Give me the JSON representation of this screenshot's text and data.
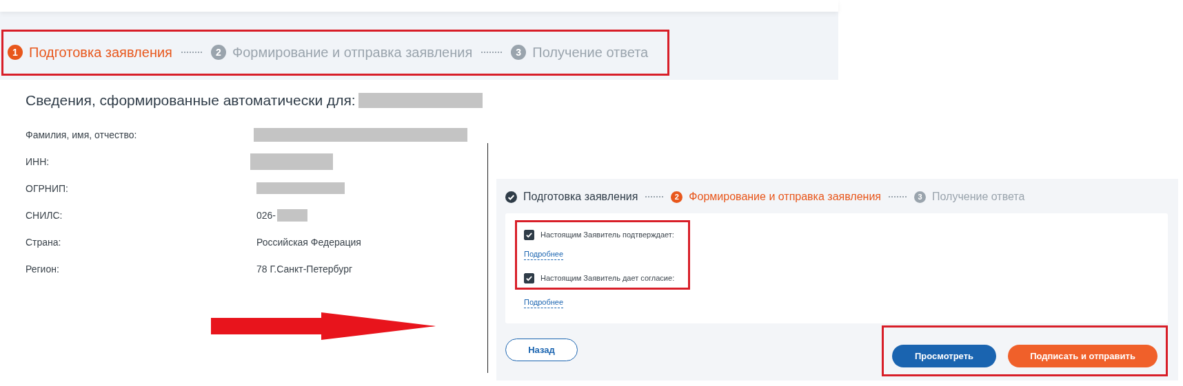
{
  "panels": [
    {
      "kind": "applicant-info",
      "stepper": {
        "highlighted": true,
        "steps": [
          {
            "number": "1",
            "label": "Подготовка заявления",
            "done": false,
            "selected": true
          },
          {
            "number": "2",
            "label": "Формирование и отправка заявления",
            "done": false,
            "selected": false
          },
          {
            "number": "3",
            "label": "Получение ответа",
            "done": false,
            "selected": false
          }
        ]
      },
      "heading": {
        "text": "Сведения, сформированные автоматически для:",
        "redacted": true
      },
      "fields": [
        {
          "label": "Фамилия, имя, отчество:",
          "redacted": true
        },
        {
          "label": "ИНН:",
          "redacted": true
        },
        {
          "label": "ОГРНИП:",
          "redacted": true
        },
        {
          "label": "СНИЛС:",
          "value": "026-",
          "redacted": true
        },
        {
          "label": "Страна:",
          "value": "Российская Федерация"
        },
        {
          "label": "Регион:",
          "value": "78 Г.Санкт-Петербург"
        }
      ]
    },
    {
      "kind": "consents",
      "stepper": {
        "highlighted": false,
        "steps": [
          {
            "label": "Подготовка заявления",
            "done": true,
            "selected": false
          },
          {
            "number": "2",
            "label": "Формирование и отправка заявления",
            "done": false,
            "selected": true
          },
          {
            "number": "3",
            "label": "Получение ответа",
            "done": false,
            "selected": false
          }
        ]
      },
      "consents": {
        "highlighted": true,
        "items": [
          {
            "label": "Настоящим Заявитель подтверждает:",
            "checked": true,
            "link": "Подробнее"
          },
          {
            "label": "Настоящим Заявитель дает согласие:",
            "checked": true,
            "link": "Подробнее"
          }
        ]
      },
      "back_button": "Назад",
      "actions": {
        "highlighted": true,
        "buttons": [
          {
            "label": "Просмотреть",
            "kind": "secondary"
          },
          {
            "label": "Подписать и отправить",
            "kind": "primary"
          }
        ]
      }
    }
  ],
  "arrow": true
}
